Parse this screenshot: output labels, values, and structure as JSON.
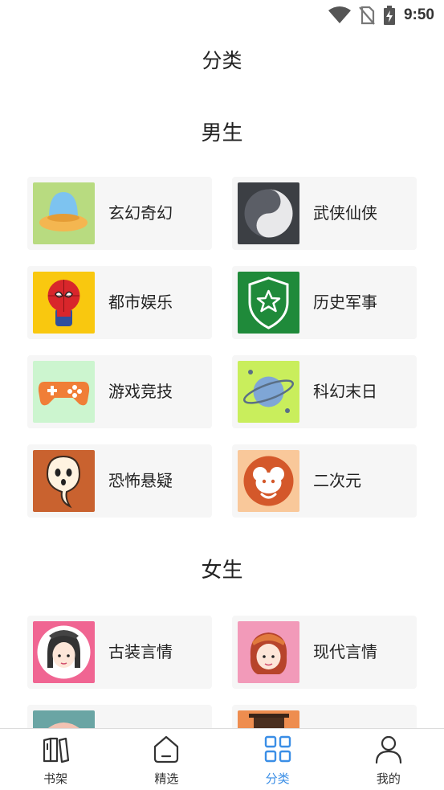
{
  "status_bar": {
    "time": "9:50",
    "icons": [
      "wifi-icon",
      "no-sim-icon",
      "battery-charging-icon"
    ]
  },
  "header": {
    "title": "分类"
  },
  "sections": [
    {
      "title": "男生",
      "items": [
        {
          "label": "玄幻奇幻",
          "icon": "ufo-icon",
          "bg": "#b8db80"
        },
        {
          "label": "武侠仙侠",
          "icon": "yin-yang-icon",
          "bg": "#3c3f44"
        },
        {
          "label": "都市娱乐",
          "icon": "spiderman-icon",
          "bg": "#f9c80f"
        },
        {
          "label": "历史军事",
          "icon": "shield-star-icon",
          "bg": "#1f8a3a"
        },
        {
          "label": "游戏竞技",
          "icon": "gamepad-icon",
          "bg": "#ccf5cf"
        },
        {
          "label": "科幻末日",
          "icon": "planet-icon",
          "bg": "#c9ee5c"
        },
        {
          "label": "恐怖悬疑",
          "icon": "ghost-icon",
          "bg": "#c9622f"
        },
        {
          "label": "二次元",
          "icon": "bear-icon",
          "bg": "#f9c89a"
        }
      ]
    },
    {
      "title": "女生",
      "items": [
        {
          "label": "古装言情",
          "icon": "ancient-girl-icon",
          "bg": "#f06592"
        },
        {
          "label": "现代言情",
          "icon": "modern-girl-icon",
          "bg": "#f29ab9"
        },
        {
          "label": "",
          "icon": "partial-icon",
          "bg": "#6aa5a4"
        },
        {
          "label": "",
          "icon": "partial-icon",
          "bg": "#ee8d4f"
        }
      ]
    }
  ],
  "tabbar": {
    "active_color": "#3a8ee6",
    "tabs": [
      {
        "label": "书架",
        "icon": "bookshelf-icon"
      },
      {
        "label": "精选",
        "icon": "home-icon"
      },
      {
        "label": "分类",
        "icon": "category-grid-icon",
        "active": true
      },
      {
        "label": "我的",
        "icon": "user-icon"
      }
    ]
  }
}
